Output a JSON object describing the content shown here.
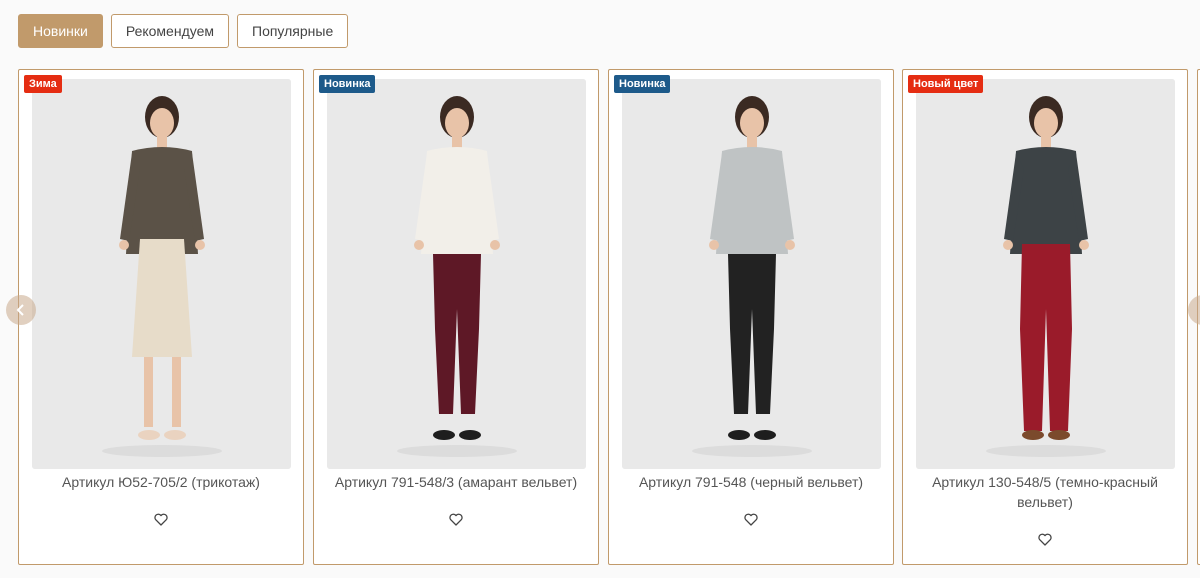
{
  "tabs": [
    {
      "label": "Новинки",
      "active": true
    },
    {
      "label": "Рекомендуем",
      "active": false
    },
    {
      "label": "Популярные",
      "active": false
    }
  ],
  "products": [
    {
      "badge": "Зима",
      "badge_color": "#e52d12",
      "title": "Артикул Ю52-705/2 (трикотаж)",
      "top_color": "#5b5247",
      "bottom_color": "#e7dcc9",
      "bottom_type": "skirt",
      "shoe_color": "#ead3c0"
    },
    {
      "badge": "Новинка",
      "badge_color": "#1d5a8a",
      "title": "Артикул 791-548/3 (амарант вельвет)",
      "top_color": "#f2efe9",
      "bottom_color": "#5e1826",
      "bottom_type": "pants",
      "shoe_color": "#1e1e1e"
    },
    {
      "badge": "Новинка",
      "badge_color": "#1d5a8a",
      "title": "Артикул 791-548 (черный вельвет)",
      "top_color": "#bfc3c4",
      "bottom_color": "#222222",
      "bottom_type": "pants",
      "shoe_color": "#1e1e1e"
    },
    {
      "badge": "Новый цвет",
      "badge_color": "#e52d12",
      "title": "Артикул 130-548/5 (темно-красный вельвет)",
      "top_color": "#3d4346",
      "bottom_color": "#9a1b2a",
      "bottom_type": "flared",
      "shoe_color": "#7b4a2c"
    }
  ],
  "icons": {
    "favorite": "heart-outline-icon",
    "prev": "chevron-left-icon",
    "next": "chevron-right-icon"
  },
  "colors": {
    "accent": "#c19a6b",
    "photo_bg": "#e9e9e9"
  }
}
